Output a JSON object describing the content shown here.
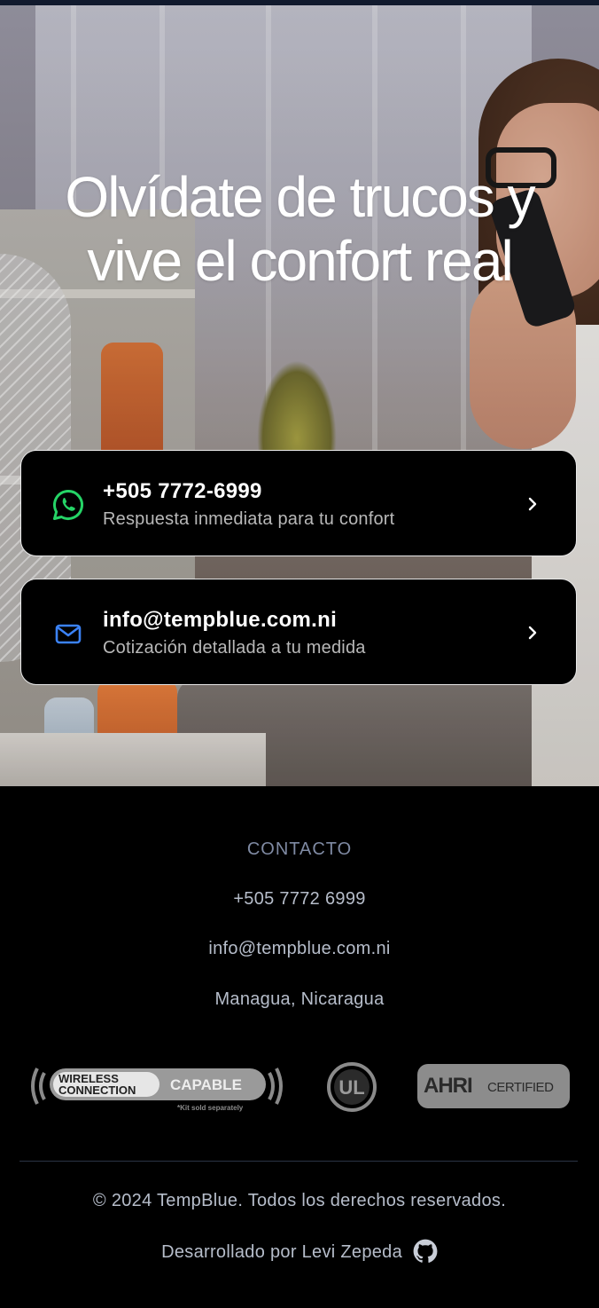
{
  "hero": {
    "title_line1": "Olvídate de trucos y",
    "title_line2": "vive el confort real"
  },
  "contact_cards": [
    {
      "icon": "whatsapp-icon",
      "main": "+505 7772-6999",
      "sub": "Respuesta inmediata para tu confort",
      "icon_color": "#25d366"
    },
    {
      "icon": "mail-icon",
      "main": "info@tempblue.com.ni",
      "sub": "Cotización detallada a tu medida",
      "icon_color": "#3b82f6"
    }
  ],
  "footer": {
    "heading": "CONTACTO",
    "phone": "+505 7772 6999",
    "email": "info@tempblue.com.ni",
    "location": "Managua, Nicaragua",
    "badges": {
      "wireless": {
        "line1": "WIRELESS",
        "line2": "CONNECTION",
        "capable": "CAPABLE",
        "note": "*Kit sold separately"
      },
      "ul": "UL",
      "ahri": {
        "brand": "AHRI",
        "certified": "CERTIFIED"
      }
    },
    "copyright": "© 2024 TempBlue. Todos los derechos reservados.",
    "developed_by": "Desarrollado por Levi Zepeda"
  },
  "colors": {
    "background": "#000000",
    "muted_heading": "#7f8aa3",
    "footer_text": "#b6bdca"
  }
}
